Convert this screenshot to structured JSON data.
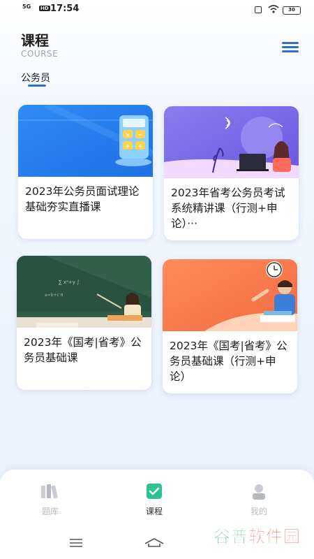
{
  "status_bar": {
    "signal": "5G",
    "hd": "HD",
    "time": "17:54",
    "battery": "30"
  },
  "header": {
    "title": "课程",
    "subtitle": "COURSE",
    "menu_icon": "menu-icon"
  },
  "tabs": [
    {
      "label": "公务员",
      "active": true
    }
  ],
  "courses": [
    {
      "title": "2023年公务员面试理论基础夯实直播课",
      "thumb": "calculator-illustration"
    },
    {
      "title": "2023年省考公务员考试系统精讲课（行测+申论）···",
      "thumb": "laptop-student-illustration"
    },
    {
      "title": "2023年《国考|省考》公务员基础课",
      "thumb": "blackboard-teacher-illustration"
    },
    {
      "title": "2023年《国考|省考》公务员基础课（行测+申论）",
      "thumb": "student-clock-illustration"
    }
  ],
  "bottom_nav": [
    {
      "label": "题库",
      "icon": "books-icon",
      "active": false
    },
    {
      "label": "课程",
      "icon": "course-icon",
      "active": true
    },
    {
      "label": "我的",
      "icon": "user-icon",
      "active": false
    }
  ],
  "watermark": {
    "part1": "谷普",
    "part2": "软件园"
  },
  "colors": {
    "accent": "#2a6fd6",
    "active_nav": "#2fc48f"
  }
}
